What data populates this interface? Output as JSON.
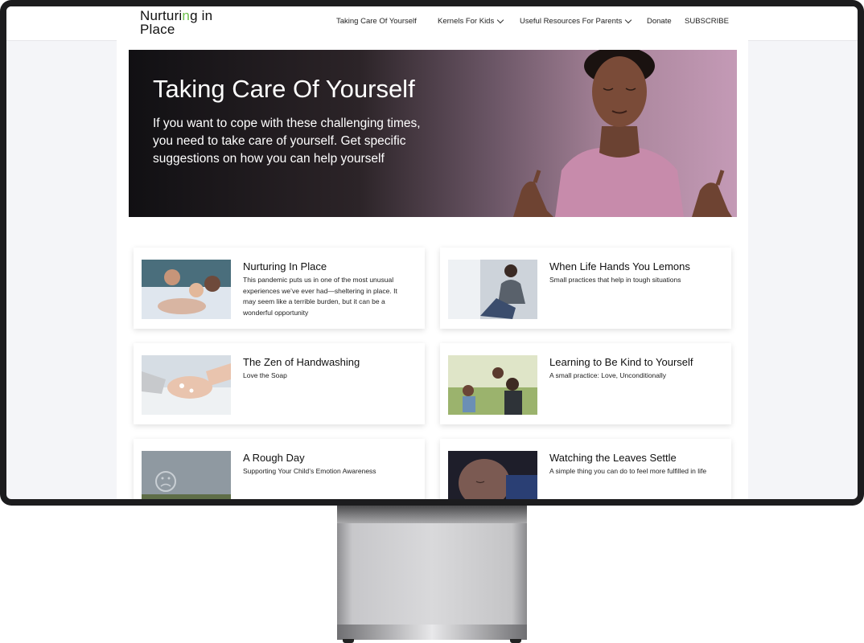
{
  "site": {
    "logo_line1": "Nurturi",
    "logo_g": "n",
    "logo_line1_end": "g in",
    "logo_line2": "Place"
  },
  "nav": {
    "items": [
      {
        "label": "Taking Care Of Yourself",
        "dropdown": false
      },
      {
        "label": "Kernels For Kids",
        "dropdown": true
      },
      {
        "label": "Useful Resources For Parents",
        "dropdown": true
      },
      {
        "label": "Donate",
        "dropdown": false
      },
      {
        "label": "SUBSCRIBE",
        "dropdown": false
      }
    ]
  },
  "hero": {
    "title": "Taking Care Of Yourself",
    "subtitle": "If you want to cope with these challenging times, you need to take care of yourself. Get specific suggestions on how you can help yourself"
  },
  "cards": [
    {
      "title": "Nurturing In Place",
      "desc": "This pandemic puts us in one of the most unusual experiences we’ve ever had—sheltering in place. It may seem like a terrible burden, but it can be a wonderful opportunity"
    },
    {
      "title": "When Life Hands You Lemons",
      "desc": "Small practices that help in tough situations"
    },
    {
      "title": "The Zen of Handwashing",
      "desc": "Love the Soap"
    },
    {
      "title": "Learning to Be Kind to Yourself",
      "desc": "A small practice: Love, Unconditionally"
    },
    {
      "title": "A Rough Day",
      "desc": "Supporting Your Child’s Emotion Awareness"
    },
    {
      "title": "Watching the Leaves Settle",
      "desc": "A simple thing you can do to feel more fulfilled in life"
    }
  ],
  "colors": {
    "logo_accent": "#6cc04a",
    "hero_dark": "#111013",
    "hero_light": "#c49ab6"
  }
}
